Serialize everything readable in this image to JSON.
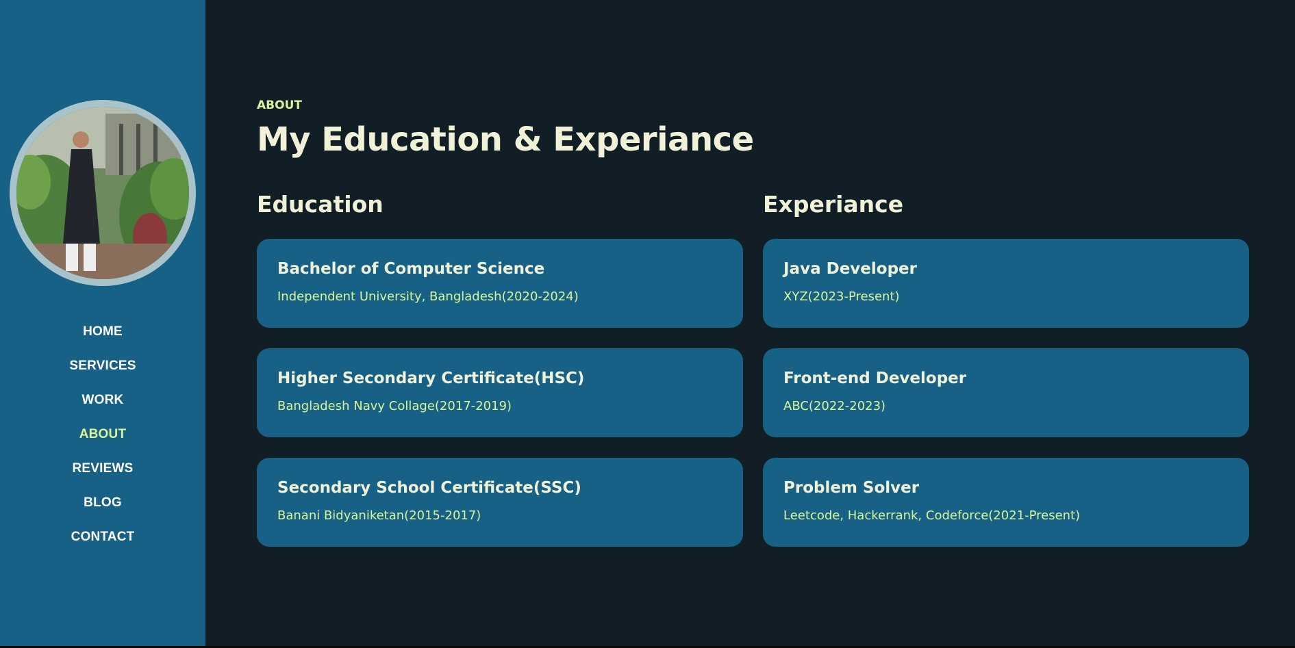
{
  "colors": {
    "background": "#111e26",
    "sidebar": "#176186",
    "card": "#176186",
    "accent": "#d8f597",
    "heading": "#f0f2d8",
    "nav_text": "#ffffff"
  },
  "sidebar": {
    "avatar_alt": "profile photo",
    "nav": [
      {
        "label": "HOME",
        "active": false
      },
      {
        "label": "SERVICES",
        "active": false
      },
      {
        "label": "WORK",
        "active": false
      },
      {
        "label": "ABOUT",
        "active": true
      },
      {
        "label": "REVIEWS",
        "active": false
      },
      {
        "label": "BLOG",
        "active": false
      },
      {
        "label": "CONTACT",
        "active": false
      }
    ]
  },
  "main": {
    "eyebrow": "ABOUT",
    "title": "My Education & Experiance",
    "education": {
      "heading": "Education",
      "items": [
        {
          "title": "Bachelor of Computer Science",
          "subtitle": "Independent University, Bangladesh(2020-2024)"
        },
        {
          "title": "Higher Secondary Certificate(HSC)",
          "subtitle": "Bangladesh Navy Collage(2017-2019)"
        },
        {
          "title": "Secondary School Certificate(SSC)",
          "subtitle": "Banani Bidyaniketan(2015-2017)"
        }
      ]
    },
    "experience": {
      "heading": "Experiance",
      "items": [
        {
          "title": "Java Developer",
          "subtitle": "XYZ(2023-Present)"
        },
        {
          "title": "Front-end Developer",
          "subtitle": "ABC(2022-2023)"
        },
        {
          "title": "Problem Solver",
          "subtitle": "Leetcode, Hackerrank, Codeforce(2021-Present)"
        }
      ]
    }
  }
}
